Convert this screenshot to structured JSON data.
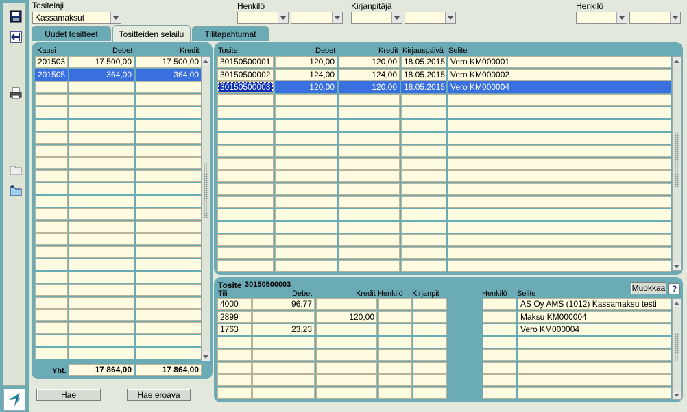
{
  "header": {
    "tositelaji_label": "Tositelaji",
    "tositelaji_value": "Kassamaksut",
    "henkilo1_label": "Henkilö",
    "kirjanpitaja_label": "Kirjanpitäjä",
    "henkilo2_label": "Henkilö"
  },
  "tabs": [
    "Uudet tositteet",
    "Tositteiden selailu",
    "Tilitapahtumat"
  ],
  "periods": {
    "headers": [
      "Kausi",
      "Debet",
      "Kredit"
    ],
    "rows": [
      [
        "201503",
        "17 500,00",
        "17 500,00"
      ],
      [
        "201505",
        "364,00",
        "364,00"
      ]
    ],
    "total_label": "Yht.",
    "total_debet": "17 864,00",
    "total_kredit": "17 864,00"
  },
  "buttons": {
    "hae": "Hae",
    "hae_eroava": "Hae eroava",
    "muokkaa": "Muokkaa",
    "help": "?"
  },
  "vouchers": {
    "headers": [
      "Tosite",
      "Debet",
      "Kredit",
      "Kirjauspäivä",
      "Selite"
    ],
    "rows": [
      [
        "30150500001",
        "120,00",
        "120,00",
        "18.05.2015",
        "Vero KM000001"
      ],
      [
        "30150500002",
        "124,00",
        "124,00",
        "18.05.2015",
        "Vero KM000002"
      ],
      [
        "30150500003",
        "120,00",
        "120,00",
        "18.05.2015",
        "Vero KM000004"
      ]
    ]
  },
  "detail": {
    "title_label": "Tosite",
    "title_value": "30150500003",
    "headers": [
      "Tili",
      "Debet",
      "Kredit",
      "Henkilö",
      "Kirjanpit",
      "Henkilö",
      "Selite"
    ],
    "rows": [
      [
        "4000",
        "96,77",
        "",
        "",
        "",
        "",
        "AS Oy AMS (1012) Kassamaksu testi"
      ],
      [
        "2899",
        "",
        "120,00",
        "",
        "",
        "",
        "Maksu KM000004"
      ],
      [
        "1763",
        "23,23",
        "",
        "",
        "",
        "",
        "Vero KM000004"
      ]
    ]
  },
  "colors": {
    "panel": "#6aabb5",
    "cell": "#fffbe0",
    "selection": "#3a6fe0",
    "background": "#e3e8dc"
  }
}
